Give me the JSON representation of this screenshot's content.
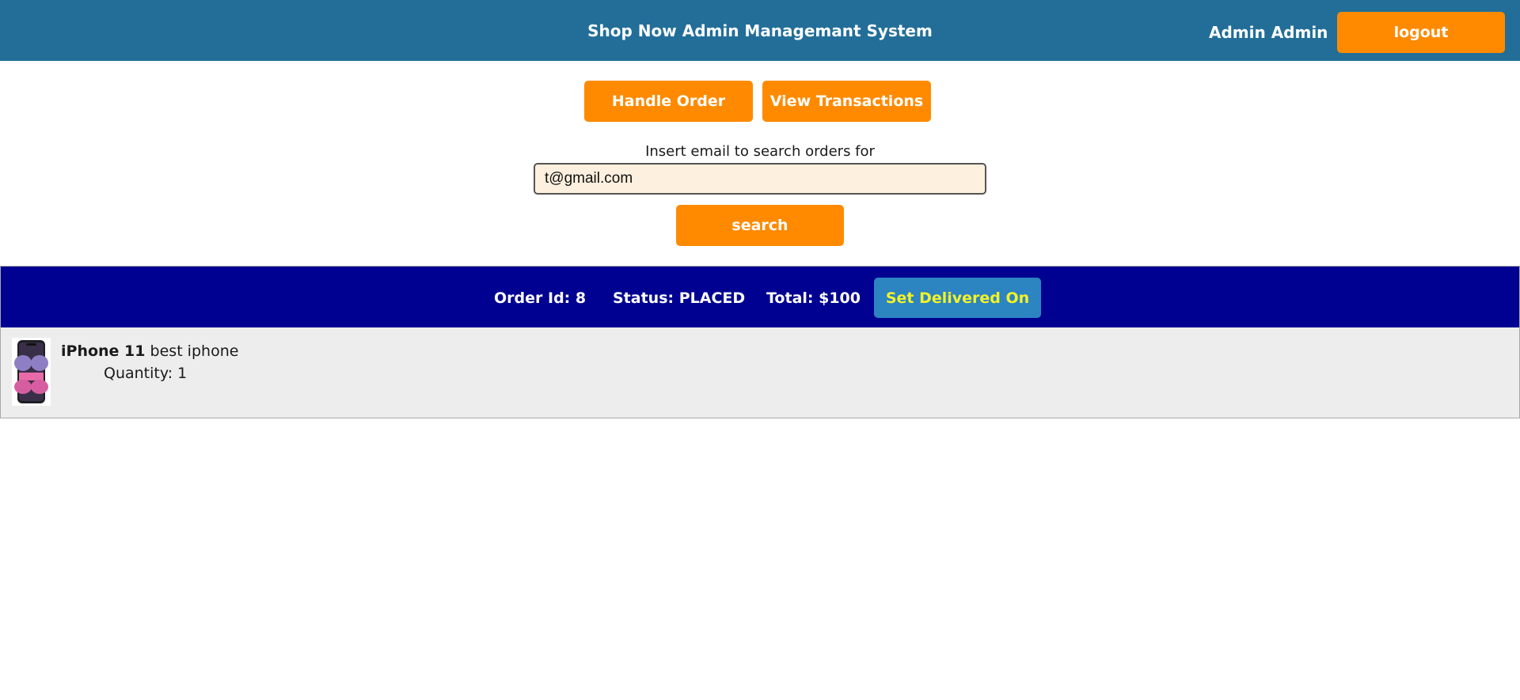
{
  "header": {
    "title": "Shop Now Admin Managemant System",
    "user_name": "Admin Admin",
    "logout_label": "logout",
    "background_color": "#226e99"
  },
  "actions": {
    "handle_order_label": "Handle Order",
    "view_transactions_label": "View Transactions"
  },
  "search": {
    "label": "Insert email to search orders for",
    "value": "t@gmail.com",
    "button_label": "search"
  },
  "orders": [
    {
      "order_id_text": "Order Id: 8",
      "status_text": "Status: PLACED",
      "total_text": "Total: $100",
      "deliver_button_label": "Set Delivered On",
      "items": [
        {
          "image_icon": "iphone-icon",
          "name": "iPhone 11",
          "description": "best iphone",
          "quantity_text": "Quantity: 1"
        }
      ]
    }
  ],
  "colors": {
    "accent_orange": "#ff8a00",
    "order_header_navy": "#000091",
    "deliver_button_blue": "#2c84c0",
    "deliver_button_text": "#f3f229",
    "input_background": "#fdf0de"
  }
}
